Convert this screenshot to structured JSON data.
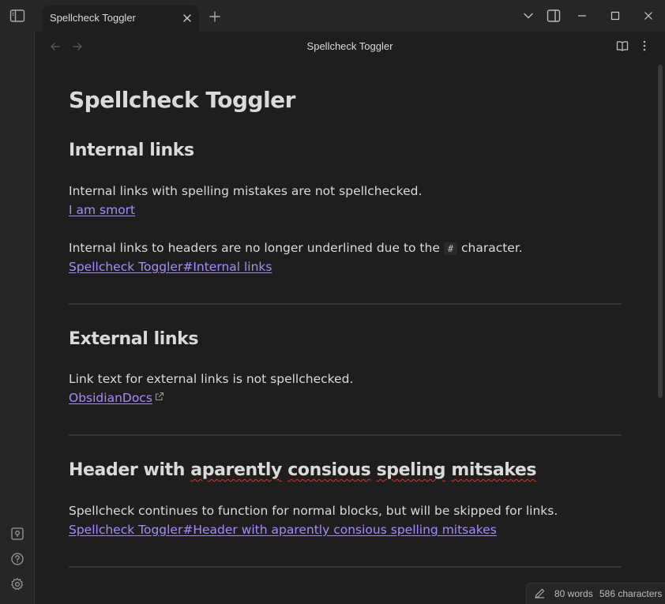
{
  "tab": {
    "title": "Spellcheck Toggler"
  },
  "view_header": {
    "title": "Spellcheck Toggler"
  },
  "note": {
    "title": "Spellcheck Toggler",
    "sections": [
      {
        "heading": "Internal links",
        "para1": "Internal links with spelling mistakes are not spellchecked.",
        "link1": "I am smort",
        "para2_before": "Internal links to headers are no longer underlined due to the",
        "para2_code": "#",
        "para2_after": "character.",
        "link2": "Spellcheck Toggler#Internal links"
      },
      {
        "heading": "External links",
        "para": "Link text for external links is not spellchecked.",
        "link": "ObsidianDocs"
      },
      {
        "heading_words": [
          "Header with",
          "aparently",
          "consious",
          "speling",
          "mitsakes"
        ],
        "para": "Spellcheck continues to function for normal blocks, but will be skipped for links.",
        "link": "Spellcheck Toggler#Header with aparently consious spelling mitsakes"
      }
    ]
  },
  "status_bar": {
    "words": "80 words",
    "characters": "586 characters"
  },
  "icons": {
    "sidebar_toggle": "sidebar-toggle-icon",
    "tab_close": "close-icon",
    "new_tab": "plus-icon",
    "tab_list": "chevron-down-icon",
    "right_sidebar": "right-sidebar-icon",
    "minimize": "minimize-icon",
    "maximize": "maximize-icon",
    "close_window": "close-icon",
    "back": "arrow-left-icon",
    "forward": "arrow-right-icon",
    "reading_view": "book-open-icon",
    "more_options": "more-vertical-icon",
    "vault_switcher": "vault-icon",
    "help": "help-icon",
    "settings": "gear-icon",
    "external_link": "external-link-icon",
    "edit_mode": "pencil-icon"
  },
  "colors": {
    "link": "#a88bfa",
    "background": "#1e1e1e",
    "chrome": "#262626",
    "spell_error": "#e03131"
  }
}
